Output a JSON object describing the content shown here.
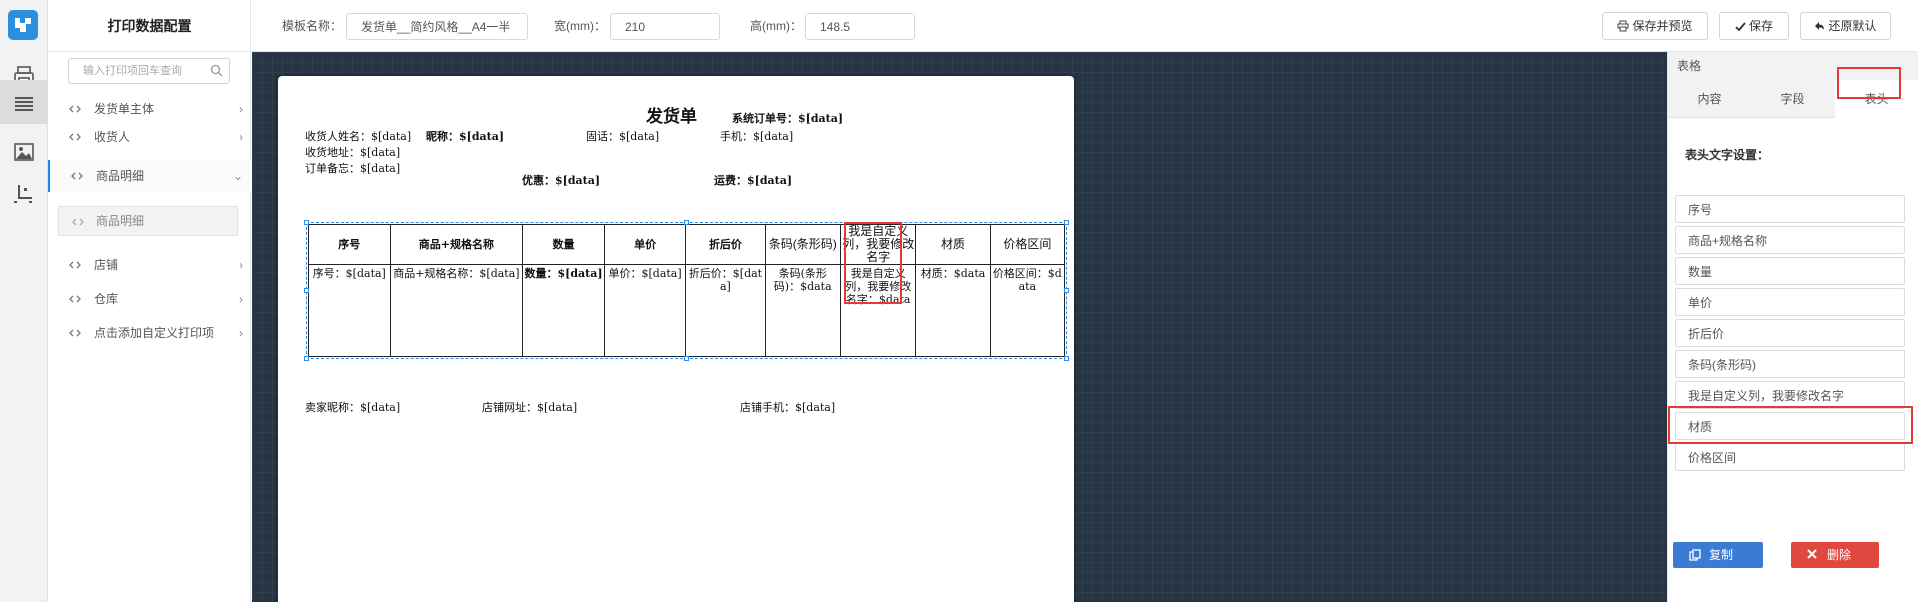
{
  "sidebar": {
    "title": "打印数据配置",
    "search_placeholder": "输入打印项回车查询",
    "items": [
      {
        "label": "发货单主体",
        "arrow": "›"
      },
      {
        "label": "收货人",
        "arrow": "›"
      },
      {
        "label": "商品明细",
        "arrow": "⌄"
      },
      {
        "label": "店铺",
        "arrow": "›"
      },
      {
        "label": "仓库",
        "arrow": "›"
      },
      {
        "label": "点击添加自定义打印项",
        "arrow": "›"
      }
    ],
    "sub_item": "商品明细"
  },
  "toolbar": {
    "template_label": "模板名称：",
    "template_value": "发货单__简约风格__A4一半",
    "width_label": "宽(mm)：",
    "width_value": "210",
    "height_label": "高(mm)：",
    "height_value": "148.5",
    "save_preview": "保存并预览",
    "save": "保存",
    "restore": "还原默认"
  },
  "paper": {
    "title": "发货单",
    "order_no": "系统订单号：$[data]",
    "receiver_name": "收货人姓名：$[data]",
    "nickname": "昵称：$[data]",
    "landline": "固话：$[data]",
    "mobile": "手机：$[data]",
    "address": "收货地址：$[data]",
    "remark": "订单备忘：$[data]",
    "discount": "优惠：$[data]",
    "shipping": "运费：$[data]",
    "seller": "卖家昵称：$[data]",
    "shop_url": "店铺网址：$[data]",
    "shop_phone": "店铺手机：$[data]",
    "table": {
      "headers": [
        "序号",
        "商品+规格名称",
        "数量",
        "单价",
        "折后价",
        "条码(条形码)",
        "我是自定义列，我要修改名字",
        "材质",
        "价格区间"
      ],
      "cells": [
        "序号：$[data]",
        "商品+规格名称：$[data]",
        "数量：$[data]",
        "单价：$[data]",
        "折后价：$[data]",
        "条码(条形码)：$data",
        "我是自定义列，我要修改名字：$data",
        "材质：$data",
        "价格区间：$data"
      ]
    }
  },
  "panel": {
    "title": "表格",
    "tabs": [
      "内容",
      "字段",
      "表头"
    ],
    "active_tab": "表头",
    "section_label": "表头文字设置：",
    "fields": [
      "序号",
      "商品+规格名称",
      "数量",
      "单价",
      "折后价",
      "条码(条形码)",
      "我是自定义列，我要修改名字",
      "材质",
      "价格区间"
    ],
    "copy_label": "复制",
    "delete_label": "删除"
  },
  "colors": {
    "accent": "#1e88e5",
    "canvas": "#263444",
    "highlight": "#e53935",
    "copy_button": "#3a7bd5",
    "delete_button": "#e0473e"
  },
  "icons": [
    "logo-icon",
    "printer-icon",
    "list-icon",
    "image-icon",
    "crop-icon",
    "search-icon",
    "link-icon",
    "printer-icon",
    "check-icon",
    "undo-icon",
    "copy-icon",
    "close-icon"
  ]
}
